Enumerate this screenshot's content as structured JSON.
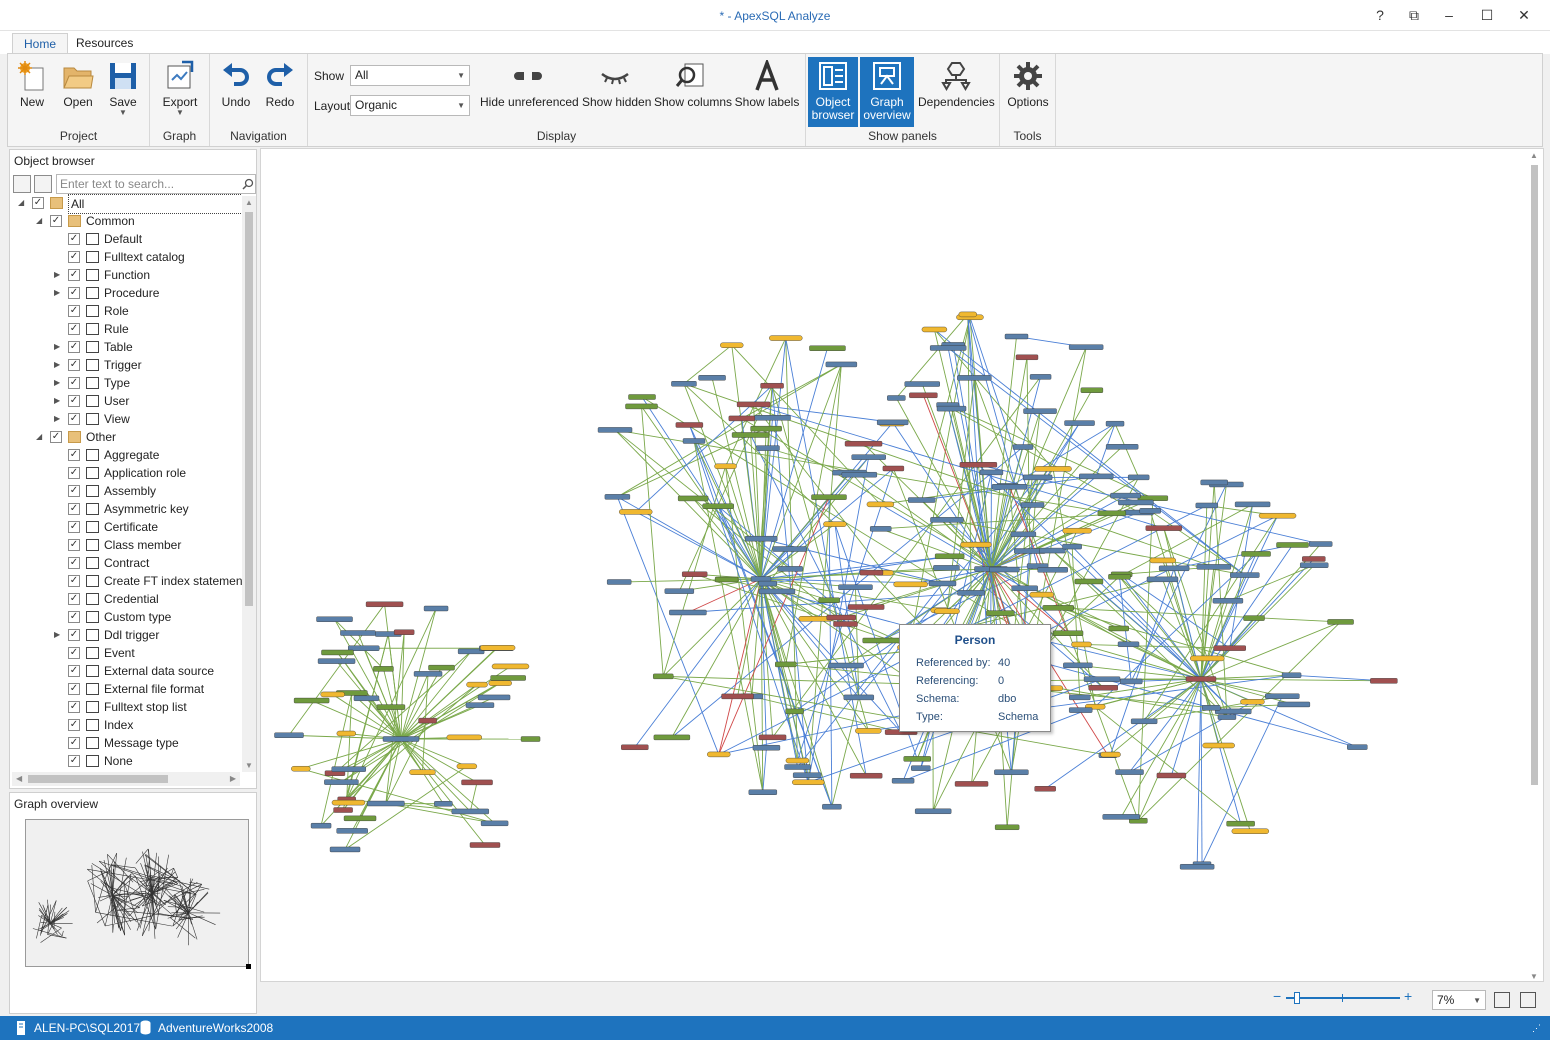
{
  "window": {
    "title": "* - ApexSQL Analyze",
    "controls": {
      "help": "?",
      "restore": "⧉",
      "minimize": "–",
      "maximize": "☐",
      "close": "✕"
    }
  },
  "tabs": [
    {
      "label": "Home",
      "active": true
    },
    {
      "label": "Resources",
      "active": false
    }
  ],
  "ribbon": {
    "project": {
      "label": "Project",
      "new": "New",
      "open": "Open",
      "save": "Save"
    },
    "graph": {
      "label": "Graph",
      "export": "Export"
    },
    "navigation": {
      "label": "Navigation",
      "undo": "Undo",
      "redo": "Redo"
    },
    "display": {
      "label": "Display",
      "show_label": "Show",
      "show_value": "All",
      "layout_label": "Layout",
      "layout_value": "Organic",
      "hide_unreferenced": "Hide unreferenced",
      "show_hidden": "Show hidden",
      "show_columns": "Show columns",
      "show_labels": "Show labels"
    },
    "show_panels": {
      "label": "Show panels",
      "object_browser_1": "Object",
      "object_browser_2": "browser",
      "graph_overview_1": "Graph",
      "graph_overview_2": "overview",
      "dependencies": "Dependencies"
    },
    "tools": {
      "label": "Tools",
      "options": "Options"
    },
    "accent": "#1e73be"
  },
  "object_browser": {
    "title": "Object browser",
    "search_placeholder": "Enter text to search...",
    "tree": [
      {
        "label": "All",
        "level": 0,
        "expander": "open",
        "icon": "folder-icon"
      },
      {
        "label": "Common",
        "level": 1,
        "expander": "open",
        "icon": "folder-icon"
      },
      {
        "label": "Default",
        "level": 2,
        "expander": "none",
        "icon": "default-icon"
      },
      {
        "label": "Fulltext catalog",
        "level": 2,
        "expander": "none",
        "icon": "fulltext-catalog-icon"
      },
      {
        "label": "Function",
        "level": 2,
        "expander": "closed",
        "icon": "function-icon"
      },
      {
        "label": "Procedure",
        "level": 2,
        "expander": "closed",
        "icon": "procedure-icon"
      },
      {
        "label": "Role",
        "level": 2,
        "expander": "none",
        "icon": "role-icon"
      },
      {
        "label": "Rule",
        "level": 2,
        "expander": "none",
        "icon": "rule-icon"
      },
      {
        "label": "Table",
        "level": 2,
        "expander": "closed",
        "icon": "table-icon"
      },
      {
        "label": "Trigger",
        "level": 2,
        "expander": "closed",
        "icon": "trigger-icon"
      },
      {
        "label": "Type",
        "level": 2,
        "expander": "closed",
        "icon": "type-icon"
      },
      {
        "label": "User",
        "level": 2,
        "expander": "closed",
        "icon": "user-icon"
      },
      {
        "label": "View",
        "level": 2,
        "expander": "closed",
        "icon": "view-icon"
      },
      {
        "label": "Other",
        "level": 1,
        "expander": "open",
        "icon": "folder-icon"
      },
      {
        "label": "Aggregate",
        "level": 2,
        "expander": "none",
        "icon": "aggregate-icon"
      },
      {
        "label": "Application role",
        "level": 2,
        "expander": "none",
        "icon": "application-role-icon"
      },
      {
        "label": "Assembly",
        "level": 2,
        "expander": "none",
        "icon": "assembly-icon"
      },
      {
        "label": "Asymmetric key",
        "level": 2,
        "expander": "none",
        "icon": "asymmetric-key-icon"
      },
      {
        "label": "Certificate",
        "level": 2,
        "expander": "none",
        "icon": "certificate-icon"
      },
      {
        "label": "Class member",
        "level": 2,
        "expander": "none",
        "icon": "class-member-icon"
      },
      {
        "label": "Contract",
        "level": 2,
        "expander": "none",
        "icon": "contract-icon"
      },
      {
        "label": "Create FT index statement",
        "level": 2,
        "expander": "none",
        "icon": "ft-index-icon"
      },
      {
        "label": "Credential",
        "level": 2,
        "expander": "none",
        "icon": "credential-icon"
      },
      {
        "label": "Custom type",
        "level": 2,
        "expander": "none",
        "icon": "custom-type-icon"
      },
      {
        "label": "Ddl trigger",
        "level": 2,
        "expander": "closed",
        "icon": "ddl-trigger-icon"
      },
      {
        "label": "Event",
        "level": 2,
        "expander": "none",
        "icon": "event-icon"
      },
      {
        "label": "External data source",
        "level": 2,
        "expander": "none",
        "icon": "external-data-source-icon"
      },
      {
        "label": "External file format",
        "level": 2,
        "expander": "none",
        "icon": "external-file-format-icon"
      },
      {
        "label": "Fulltext stop list",
        "level": 2,
        "expander": "none",
        "icon": "fulltext-stop-list-icon"
      },
      {
        "label": "Index",
        "level": 2,
        "expander": "none",
        "icon": "index-icon"
      },
      {
        "label": "Message type",
        "level": 2,
        "expander": "none",
        "icon": "message-type-icon"
      },
      {
        "label": "None",
        "level": 2,
        "expander": "none",
        "icon": "none-icon"
      }
    ]
  },
  "graph_overview": {
    "title": "Graph overview"
  },
  "tooltip": {
    "title": "Person",
    "rows": [
      {
        "key": "Referenced by:",
        "value": "40"
      },
      {
        "key": "Referencing:",
        "value": "0"
      },
      {
        "key": "Schema:",
        "value": "dbo"
      },
      {
        "key": "Type:",
        "value": "Schema"
      }
    ]
  },
  "zoom": {
    "value": "7%",
    "level": 0.07
  },
  "status": {
    "server": "ALEN-PC\\SQL2017",
    "database": "AdventureWorks2008"
  },
  "colors": {
    "edge_green": "#7aa84a",
    "edge_blue": "#4a7fd6",
    "edge_red": "#d04848",
    "node_blue": "#5a7fa8",
    "node_green": "#6f9a3d",
    "node_yellow": "#f0b830",
    "node_red": "#a05050"
  }
}
